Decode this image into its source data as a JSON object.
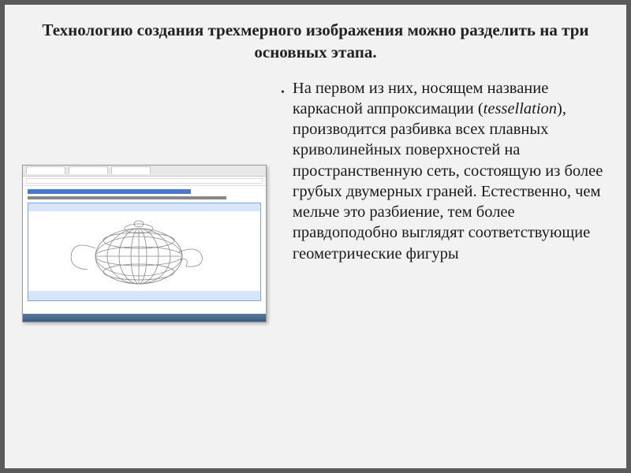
{
  "title": {
    "bold": "Технологию создания трехмерного изображения",
    "rest": " можно разделить на три основных этапа."
  },
  "bullet": {
    "part1": "На первом из них, носящем название каркасной аппроксимации (",
    "italic": "tessellation",
    "part2": "), производится разбивка всех плавных криволинейных поверхностей на пространственную сеть, состоящую из более грубых двумерных граней. Естественно, чем мельче это разбиение, тем более правдоподобно выглядят соответствующие геометрические фигуры"
  }
}
